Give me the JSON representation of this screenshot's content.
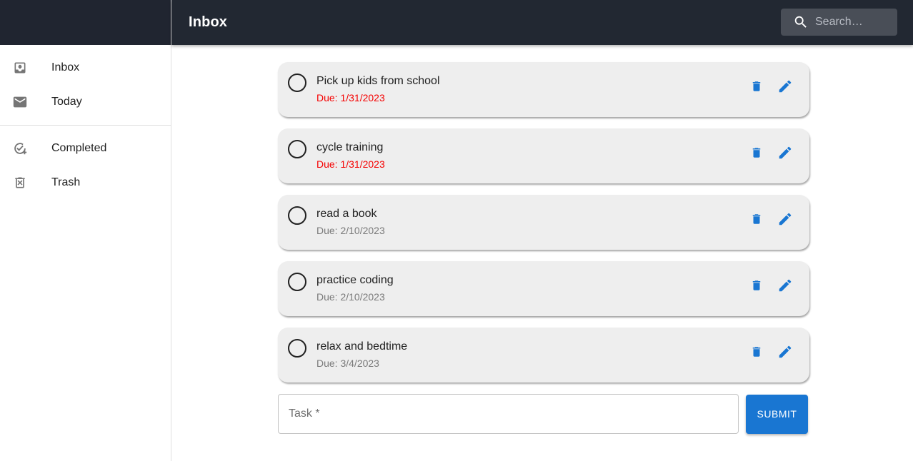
{
  "appbar": {
    "title": "Inbox",
    "search_placeholder": "Search…"
  },
  "sidebar": {
    "primary": [
      {
        "label": "Inbox",
        "icon": "inbox-icon"
      },
      {
        "label": "Today",
        "icon": "mail-icon"
      }
    ],
    "secondary": [
      {
        "label": "Completed",
        "icon": "check-circle-icon"
      },
      {
        "label": "Trash",
        "icon": "trash-icon"
      }
    ]
  },
  "tasks": [
    {
      "title": "Pick up kids from school",
      "due": "Due: 1/31/2023",
      "overdue": true
    },
    {
      "title": "cycle training",
      "due": "Due: 1/31/2023",
      "overdue": true
    },
    {
      "title": "read a book",
      "due": "Due: 2/10/2023",
      "overdue": false
    },
    {
      "title": "practice coding",
      "due": "Due: 2/10/2023",
      "overdue": false
    },
    {
      "title": "relax and bedtime",
      "due": "Due: 3/4/2023",
      "overdue": false
    }
  ],
  "form": {
    "task_placeholder": "Task *",
    "task_value": "",
    "submit_label": "SUBMIT"
  },
  "colors": {
    "appbar_bg": "#222832",
    "accent": "#1976d2",
    "overdue": "#f50000",
    "card_bg": "#eeeeee"
  }
}
